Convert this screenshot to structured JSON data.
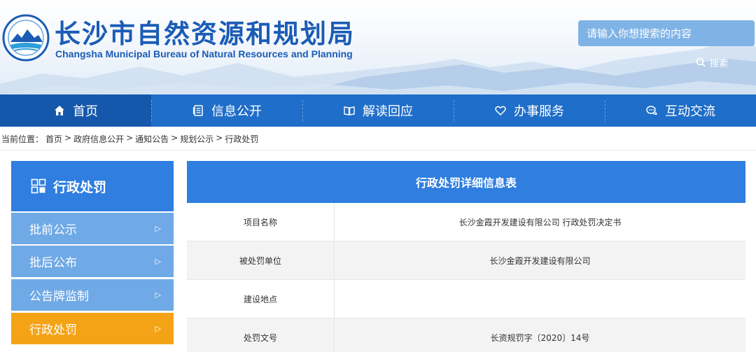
{
  "header": {
    "title_cn": "长沙市自然资源和规划局",
    "title_en": "Changsha Municipal Bureau of Natural Resources and Planning",
    "search_placeholder": "请输入你想搜索的内容",
    "search_label": "搜索"
  },
  "nav": {
    "items": [
      {
        "label": "首页",
        "icon": "home-icon"
      },
      {
        "label": "信息公开",
        "icon": "document-icon"
      },
      {
        "label": "解读回应",
        "icon": "book-icon"
      },
      {
        "label": "办事服务",
        "icon": "heart-icon"
      },
      {
        "label": "互动交流",
        "icon": "chat-icon"
      }
    ]
  },
  "breadcrumb": {
    "prefix": "当前位置：",
    "items": [
      "首页",
      "政府信息公开",
      "通知公告",
      "规划公示",
      "行政处罚"
    ],
    "separator": ">"
  },
  "sidebar": {
    "title": "行政处罚",
    "items": [
      {
        "label": "批前公示",
        "active": false
      },
      {
        "label": "批后公布",
        "active": false
      },
      {
        "label": "公告牌监制",
        "active": false
      },
      {
        "label": "行政处罚",
        "active": true
      }
    ],
    "arrow": "▷"
  },
  "detail": {
    "title": "行政处罚详细信息表",
    "rows": [
      {
        "label": "项目名称",
        "value": "长沙金霞开发建设有限公司 行政处罚决定书"
      },
      {
        "label": "被处罚单位",
        "value": "长沙金霞开发建设有限公司"
      },
      {
        "label": "建设地点",
        "value": ""
      },
      {
        "label": "处罚文号",
        "value": "长资规罚字〔2020〕14号"
      }
    ]
  },
  "colors": {
    "brand_blue": "#1f6ec9",
    "panel_blue": "#2f7ee0",
    "sidebar_light": "#6fa9e6",
    "active_orange": "#f5a316"
  }
}
